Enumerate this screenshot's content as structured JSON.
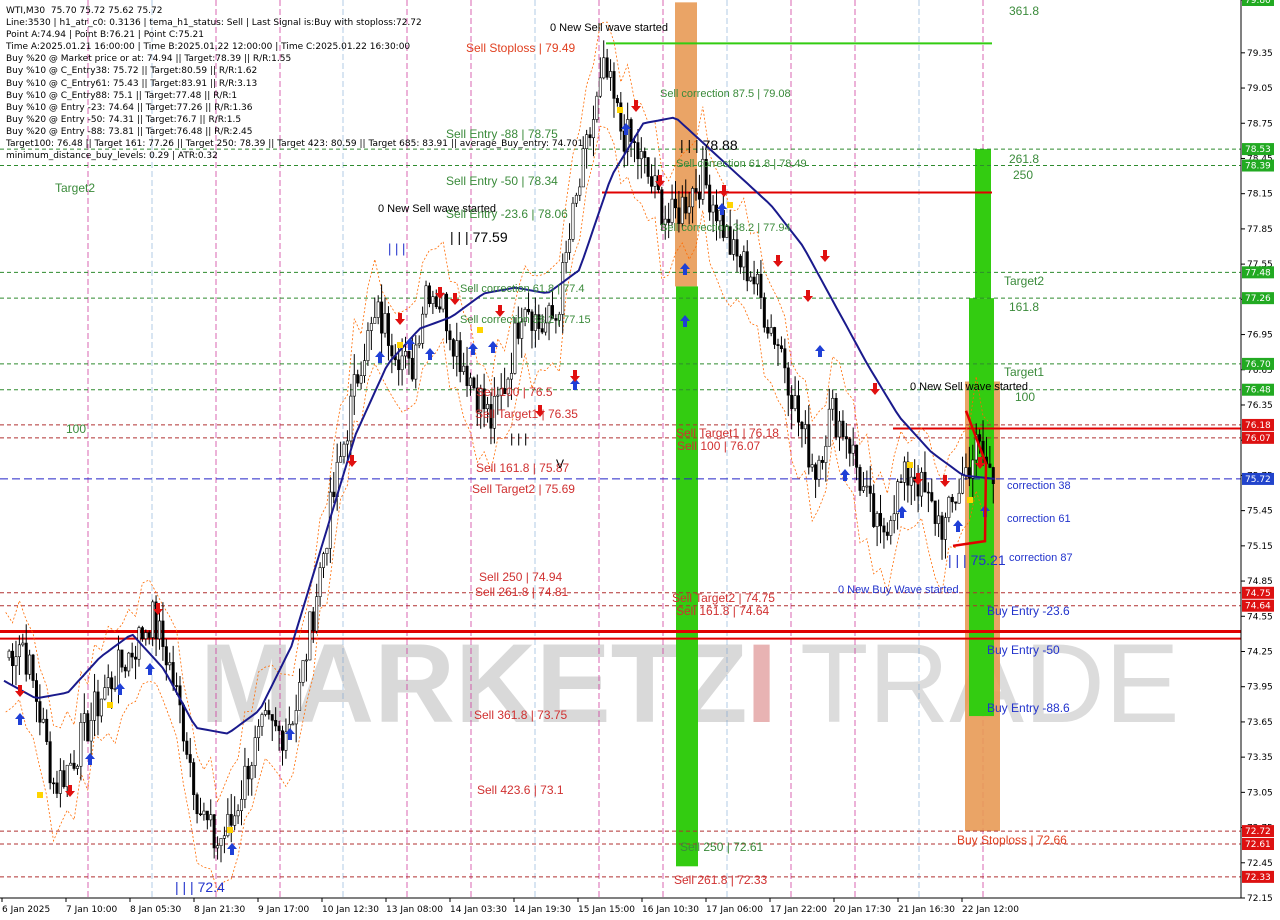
{
  "header": {
    "lines": [
      "WTI,M30  75.70 75.72 75.62 75.72",
      "Line:3530 | h1_atr_c0: 0.3136 | tema_h1_status: Sell | Last Signal is:Buy with stoploss:72.72",
      "Point A:74.94 | Point B:76.21 | Point C:75.21",
      "Time A:2025.01.21 16:00:00 | Time B:2025.01.22 12:00:00 | Time C:2025.01.22 16:30:00",
      "Buy %20 @ Market price or at: 74.94 || Target:78.39 || R/R:1.55",
      "Buy %10 @ C_Entry38: 75.72 || Target:80.59 || R/R:1.62",
      "Buy %10 @ C_Entry61: 75.43 || Target:83.91 || R/R:3.13",
      "Buy %10 @ C_Entry88: 75.1 || Target:77.48 || R/R:1",
      "Buy %10 @ Entry -23: 74.64 || Target:77.26 || R/R:1.36",
      "Buy %20 @ Entry -50: 74.31 || Target:76.7 || R/R:1.5",
      "Buy %20 @ Entry -88: 73.81 || Target:76.48 || R/R:2.45",
      "Target100: 76.48 || Target 161: 77.26 || Target 250: 78.39 || Target 423: 80.59 || Target 685: 83.91 || average_Buy_entry: 74.701",
      "minimum_distance_buy_levels: 0.29 | ATR:0.32"
    ]
  },
  "colors": {
    "background": "#ffffff",
    "bull_candle": "#000000",
    "ma_line": "#1a1a8c",
    "envelope": "#ff6a00",
    "red_level": "#e00000",
    "green_level": "#2e8b2e",
    "blue_level": "#2323c8",
    "green_bar": "#33cc11",
    "orange_bar": "#e89a55",
    "buy_arrow": "#1f3fd6",
    "sell_arrow": "#e01010",
    "watermark": "#d9d9d9",
    "tag_green": "#22aa22",
    "tag_red": "#dd1111",
    "tag_blue": "#2244cc"
  },
  "watermark": {
    "text_a": "MARKETZ",
    "text_b": "I",
    "text_c": "TRADE"
  },
  "chart_data": {
    "type": "candlestick",
    "symbol": "WTI",
    "timeframe": "M30",
    "ylim": [
      72.15,
      79.8
    ],
    "y_ticks": [
      "79.80",
      "79.35",
      "79.05",
      "78.75",
      "78.45",
      "78.15",
      "77.85",
      "77.55",
      "77.25",
      "76.95",
      "76.65",
      "76.35",
      "76.05",
      "75.75",
      "75.45",
      "75.15",
      "74.85",
      "74.55",
      "74.25",
      "73.95",
      "73.65",
      "73.35",
      "73.05",
      "72.75",
      "72.45",
      "72.15"
    ],
    "x_ticks": [
      "6 Jan 2025",
      "7 Jan 10:00",
      "8 Jan 05:30",
      "8 Jan 21:30",
      "9 Jan 17:00",
      "10 Jan 12:30",
      "13 Jan 08:00",
      "14 Jan 03:30",
      "14 Jan 19:30",
      "15 Jan 15:00",
      "16 Jan 10:30",
      "17 Jan 06:00",
      "17 Jan 22:00",
      "20 Jan 17:30",
      "21 Jan 16:30",
      "22 Jan 12:00"
    ],
    "price_path": [
      74.2,
      74.35,
      73.8,
      73.1,
      73.3,
      73.6,
      73.9,
      74.1,
      74.3,
      74.55,
      74.2,
      73.6,
      72.9,
      72.6,
      72.8,
      73.3,
      73.6,
      73.55,
      73.8,
      74.6,
      75.4,
      76.1,
      76.8,
      77.1,
      76.9,
      76.6,
      77.4,
      77.2,
      76.8,
      76.5,
      76.2,
      76.6,
      77.3,
      77.0,
      77.1,
      77.9,
      78.6,
      79.2,
      78.7,
      78.5,
      78.2,
      77.9,
      78.1,
      78.3,
      78.0,
      77.6,
      77.5,
      77.1,
      76.8,
      76.2,
      75.8,
      76.3,
      76.1,
      75.6,
      75.2,
      75.6,
      75.8,
      75.5,
      75.3,
      75.7,
      76.0,
      75.72
    ],
    "ma_path": [
      74.0,
      73.85,
      73.9,
      74.2,
      74.4,
      74.1,
      73.6,
      73.55,
      73.75,
      74.3,
      75.2,
      76.1,
      76.7,
      77.0,
      77.1,
      77.3,
      77.35,
      77.3,
      77.5,
      78.3,
      78.75,
      78.8,
      78.55,
      78.3,
      78.05,
      77.7,
      77.2,
      76.7,
      76.25,
      75.95,
      75.75,
      75.72
    ],
    "levels": [
      {
        "label": "Sell Stoploss | 79.49",
        "price": 79.49,
        "color": "red"
      },
      {
        "label": "Sell Entry -88 | 78.75",
        "price": 78.75,
        "color": "green"
      },
      {
        "label": "Sell Entry -50 | 78.34",
        "price": 78.34,
        "color": "green"
      },
      {
        "label": "Sell Entry -23.6 | 78.06",
        "price": 78.06,
        "color": "green"
      },
      {
        "label": "Sell correction 87.5 | 79.08",
        "price": 79.08,
        "color": "green"
      },
      {
        "label": "Sell correction 61.8 | 78.49",
        "price": 78.49,
        "color": "green"
      },
      {
        "label": "Sell correction 38.2 | 77.94",
        "price": 77.94,
        "color": "green"
      },
      {
        "label": "Sell correction 61.8 | 77.4",
        "price": 77.4,
        "color": "green"
      },
      {
        "label": "Sell correction 38.2 | 77.15",
        "price": 77.15,
        "color": "green"
      },
      {
        "label": "Sell Target1 | 76.18",
        "price": 76.18,
        "color": "red"
      },
      {
        "label": "Sell 100 | 76.07",
        "price": 76.07,
        "color": "red"
      },
      {
        "label": "Sell Target1 | 76.35",
        "price": 76.35,
        "color": "red"
      },
      {
        "label": "Sell 161.8 | 75.87",
        "price": 75.87,
        "color": "red"
      },
      {
        "label": "Sell Target2 | 75.69",
        "price": 75.69,
        "color": "red"
      },
      {
        "label": "Sell 250 | 74.94",
        "price": 74.94,
        "color": "red"
      },
      {
        "label": "Sell 261.8 | 74.81",
        "price": 74.81,
        "color": "red"
      },
      {
        "label": "Sell Target2 | 74.75",
        "price": 74.75,
        "color": "red"
      },
      {
        "label": "Sell 161.8 | 74.64",
        "price": 74.64,
        "color": "red"
      },
      {
        "label": "Sell 361.8 | 73.75",
        "price": 73.75,
        "color": "red"
      },
      {
        "label": "Sell 423.6 | 73.1",
        "price": 73.1,
        "color": "red"
      },
      {
        "label": "Sell 250 | 72.61",
        "price": 72.61,
        "color": "green"
      },
      {
        "label": "Sell 261.8 | 72.33",
        "price": 72.33,
        "color": "green"
      },
      {
        "label": "Buy Entry -23.6",
        "price": 74.64,
        "color": "blue"
      },
      {
        "label": "Buy Entry -50",
        "price": 74.31,
        "color": "blue"
      },
      {
        "label": "Buy Entry -88.6",
        "price": 73.81,
        "color": "blue"
      },
      {
        "label": "Buy Stoploss | 72.66",
        "price": 72.66,
        "color": "red"
      },
      {
        "label": "correction 38",
        "price": 75.72,
        "color": "blue"
      },
      {
        "label": "correction 61",
        "price": 75.43,
        "color": "blue"
      },
      {
        "label": "correction 87",
        "price": 75.1,
        "color": "blue"
      }
    ],
    "texts": {
      "sell_stoploss": "Sell Stoploss | 79.49",
      "new_sell_top": "0 New Sell wave started",
      "new_sell_mid": "0 New Sell wave started",
      "new_sell_right": "0 New Sell wave started",
      "new_buy": "0 New Buy Wave started",
      "sell_entry_88": "Sell Entry -88 | 78.75",
      "sell_entry_50": "Sell Entry -50 | 78.34",
      "sell_entry_236": "Sell Entry -23.6 | 78.06",
      "corr_875": "Sell correction 87.5 | 79.08",
      "corr_618a": "Sell correction 61.8 | 78.49",
      "corr_382a": "Sell correction 38.2 | 77.94",
      "corr_618b": "Sell correction 61.8 | 77.4",
      "corr_382b": "Sell correction 38.2 | 77.15",
      "iii_7888": "| | | 78.88",
      "iii_7759": "| | | 77.59",
      "iii_7521": "| | | 75.21",
      "iii_724": "| | | 72.4",
      "iii_mid": "| | |",
      "iii_small": "| | |",
      "sell_100_left": "Sell 100 | 76.5",
      "sell_target1_left": "Sell Target1 | 76.35",
      "sell_1618_left": "Sell 161.8 | 75.87",
      "sell_target2_left": "Sell Target2 | 75.69",
      "sell_250_left": "Sell 250 | 74.94",
      "sell_2618_left": "Sell 261.8 | 74.81",
      "sell_3618": "Sell 361.8 | 73.75",
      "sell_4236": "Sell 423.6 | 73.1",
      "sell_target1_mid": "Sell Target1 | 76.18",
      "sell_100_mid": "Sell 100 | 76.07",
      "sell_target2_mid": "Sell Target2 | 74.75",
      "sell_1618_mid": "Sell 161.8 | 74.64",
      "sell_250_bot": "Sell 250 | 72.61",
      "sell_2618_bot": "Sell 261.8 | 72.33",
      "target2_left": "Target2",
      "label_100_left": "100",
      "fib_3618": "361.8",
      "fib_2618": "261.8",
      "fib_250": "250",
      "target2_right": "Target2",
      "fib_1618": "161.8",
      "target1_right": "Target1",
      "fib_100": "100",
      "correction_38": "correction 38",
      "correction_61": "correction 61",
      "correction_87": "correction 87",
      "buy_entry_236": "Buy Entry -23.6",
      "buy_entry_50": "Buy Entry -50",
      "buy_entry_886": "Buy Entry -88.6",
      "buy_stoploss": "Buy Stoploss | 72.66",
      "v_mark": "V"
    },
    "price_tags": [
      {
        "text": "79.80",
        "price": 79.8,
        "kind": "green"
      },
      {
        "text": "78.53",
        "price": 78.53,
        "kind": "green"
      },
      {
        "text": "78.39",
        "price": 78.39,
        "kind": "green"
      },
      {
        "text": "77.48",
        "price": 77.48,
        "kind": "green"
      },
      {
        "text": "77.26",
        "price": 77.26,
        "kind": "green"
      },
      {
        "text": "76.70",
        "price": 76.7,
        "kind": "green"
      },
      {
        "text": "76.48",
        "price": 76.48,
        "kind": "green"
      },
      {
        "text": "76.18",
        "price": 76.18,
        "kind": "red"
      },
      {
        "text": "76.07",
        "price": 76.07,
        "kind": "red"
      },
      {
        "text": "75.72",
        "price": 75.72,
        "kind": "blue"
      },
      {
        "text": "74.75",
        "price": 74.75,
        "kind": "red"
      },
      {
        "text": "74.64",
        "price": 74.64,
        "kind": "red"
      },
      {
        "text": "72.72",
        "price": 72.72,
        "kind": "red"
      },
      {
        "text": "72.61",
        "price": 72.61,
        "kind": "red"
      },
      {
        "text": "72.33",
        "price": 72.33,
        "kind": "red"
      }
    ]
  }
}
